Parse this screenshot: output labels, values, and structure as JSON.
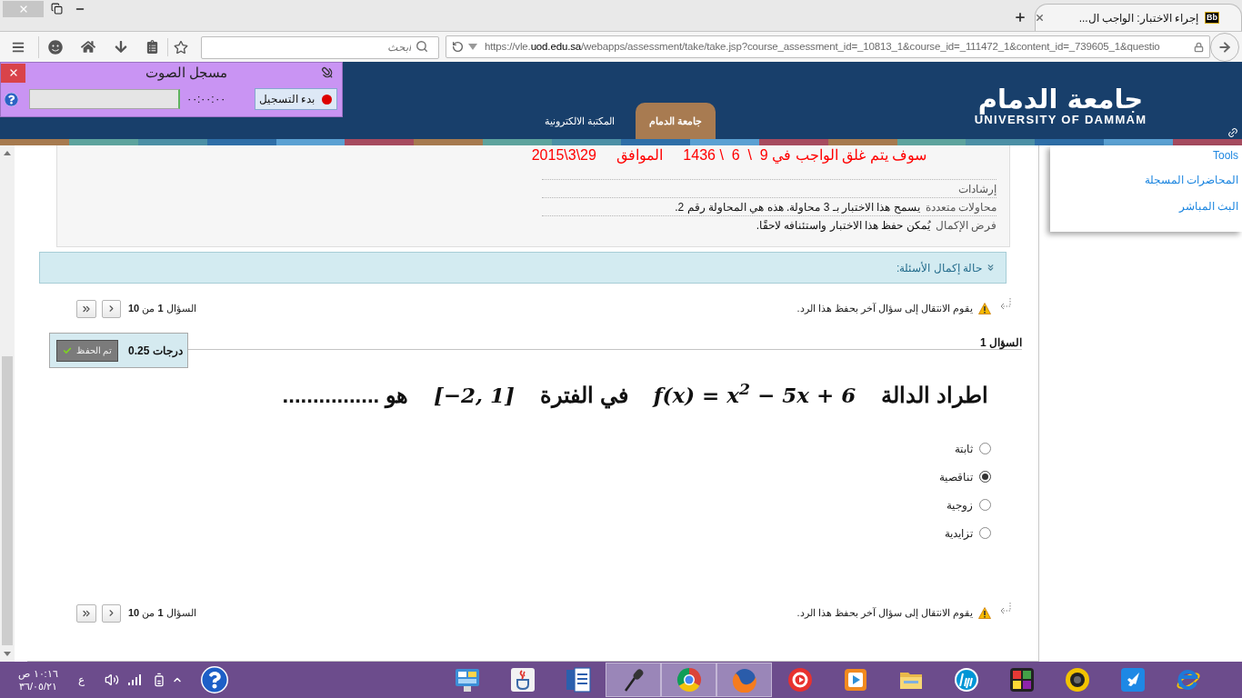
{
  "browser": {
    "tab": {
      "favicon": "Bb",
      "title": "إجراء الاختبار: الواجب ال..."
    },
    "search": {
      "placeholder": "ابحث"
    },
    "url": {
      "prefix": "https://vle.",
      "domain": "uod.edu.sa",
      "path": "/webapps/assessment/take/take.jsp?course_assessment_id=_10813_1&course_id=_111472_1&content_id=_739605_1&questio"
    }
  },
  "recorder": {
    "title": "مسجل الصوت",
    "record_button": "بدء التسجيل",
    "time": "٠٠:٠٠:٠٠"
  },
  "header": {
    "logo": {
      "arabic": "جامعة الدمام",
      "english": "UNIVERSITY OF DAMMAM"
    },
    "tabs": [
      {
        "label": "جامعة الدمام",
        "selected": true
      },
      {
        "label": "المكتبة الالكترونية",
        "selected": false
      }
    ]
  },
  "assessment": {
    "deadline": "سوف يتم غلق الواجب في 9  \\  6  \\ 1436     الموافق     29\\3\\2015",
    "instructions": [
      {
        "label": "إرشادات"
      },
      {
        "label": "محاولات متعددة",
        "value": "يسمح هذا الاختبار بـ 3 محاولة. هذه هي المحاولة رقم 2."
      },
      {
        "label": "فرض الإكمال",
        "value": "يُمكن حفظ هذا الاختبار واستئنافه لاحقًا."
      }
    ],
    "completion_status": "حالة إكمال الأسئلة:"
  },
  "navigation_top": {
    "notice": "يقوم الانتقال إلى سؤال آخر بحفظ هذا الرد.",
    "position": "السؤال **1** من **10**"
  },
  "question": {
    "title": "السؤال 1",
    "points": "0.25 درجات",
    "save_button": "تم الحفظ",
    "prompt": [
      {
        "kind": "text",
        "text": "اطراد الدالة"
      },
      {
        "kind": "math",
        "text": "f(x) = x$^{2}$ − 5x + 6"
      },
      {
        "kind": "text",
        "text": "في الفترة"
      },
      {
        "kind": "math",
        "text": "[−2, 1]"
      },
      {
        "kind": "text",
        "text": "هو ................"
      }
    ],
    "options": [
      {
        "label": "ثابتة",
        "selected": false
      },
      {
        "label": "تناقصية",
        "selected": true
      },
      {
        "label": "زوجية",
        "selected": false
      },
      {
        "label": "تزايدية",
        "selected": false
      }
    ]
  },
  "navigation_bottom": {
    "notice": "يقوم الانتقال إلى سؤال آخر بحفظ هذا الرد.",
    "position": "السؤال **1** من **10**"
  },
  "side_panel": {
    "links": [
      "Tools",
      "المحاضرات المسجلة",
      "البث المباشر"
    ]
  },
  "taskbar": {
    "clock": {
      "time": "١٠:١٦ ص",
      "date": "٣٦/٠٥/٢١"
    },
    "language": "ع",
    "apps": [
      {
        "kind": "gauges",
        "active": false
      },
      {
        "kind": "cup",
        "active": false
      },
      {
        "kind": "document",
        "active": false
      },
      {
        "kind": "microphone",
        "active": true
      },
      {
        "kind": "ball",
        "active": true
      },
      {
        "kind": "globe",
        "active": true
      },
      {
        "kind": "ring",
        "active": false
      },
      {
        "kind": "play",
        "active": false
      },
      {
        "kind": "folder",
        "active": false
      },
      {
        "kind": "round-logo",
        "active": false
      },
      {
        "kind": "puzzle",
        "active": false
      },
      {
        "kind": "webcam",
        "active": false
      },
      {
        "kind": "rocket",
        "active": false
      },
      {
        "kind": "e-globe",
        "active": false
      }
    ]
  }
}
